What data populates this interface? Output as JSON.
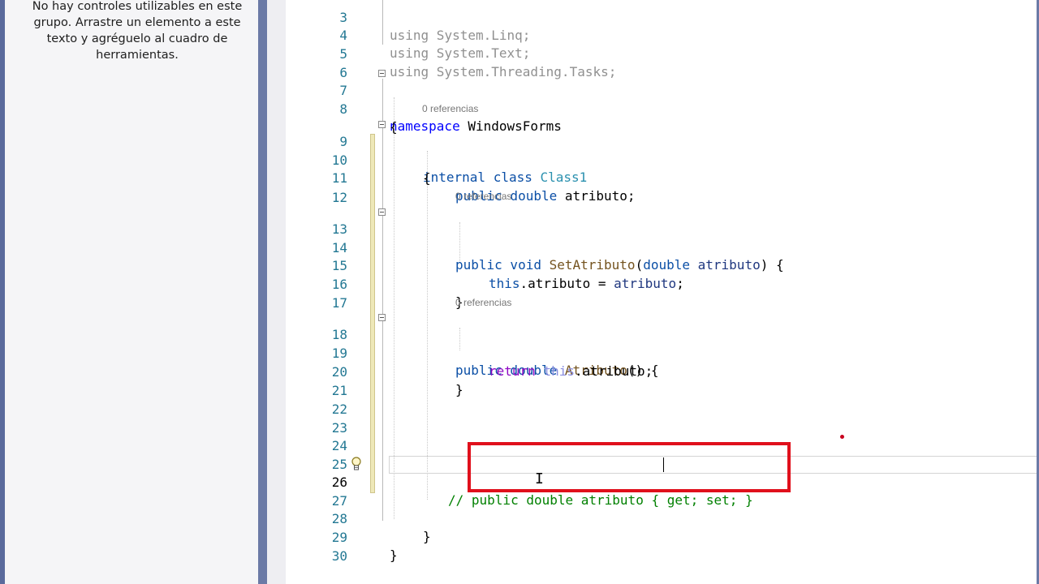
{
  "toolbox": {
    "message_line1": "No hay controles utilizables en este",
    "message_line2": "grupo. Arrastre un elemento a este",
    "message_line3": "texto y agréguelo al cuadro de",
    "message_line4": "herramientas."
  },
  "editor": {
    "codelens": {
      "class_refs": "0 referencias",
      "setatributo_refs": "0 referencias",
      "atributo_refs": "0 referencias"
    },
    "lines": {
      "l3": {
        "num": "3",
        "a": "using",
        "b": " System.Linq;"
      },
      "l4": {
        "num": "4",
        "a": "using",
        "b": " System.Text;"
      },
      "l5": {
        "num": "5",
        "a": "using",
        "b": " System.Threading.Tasks;"
      },
      "l6": {
        "num": "6"
      },
      "l7": {
        "num": "7",
        "a": "namespace",
        "b": " WindowsForms"
      },
      "l8": {
        "num": "8",
        "a": "{"
      },
      "l9": {
        "num": "9",
        "a": "internal class ",
        "b": "Class1"
      },
      "l10": {
        "num": "10",
        "a": "{"
      },
      "l11": {
        "num": "11",
        "a": "public double ",
        "b": "atributo;"
      },
      "l12": {
        "num": "12"
      },
      "l13": {
        "num": "13",
        "a": "public void ",
        "b": "SetAtributo",
        "c": "(",
        "d": "double ",
        "e": "atributo",
        "f": ") {"
      },
      "l14": {
        "num": "14"
      },
      "l15": {
        "num": "15",
        "a": "this",
        "b": ".atributo = ",
        "c": "atributo",
        "d": ";"
      },
      "l16": {
        "num": "16",
        "a": "}"
      },
      "l17": {
        "num": "17"
      },
      "l18": {
        "num": "18",
        "a": "public double ",
        "b": "Atributo",
        "c": "() {"
      },
      "l19": {
        "num": "19",
        "a": "return ",
        "b": "this",
        "c": ".atributo;"
      },
      "l20": {
        "num": "20",
        "a": "}"
      },
      "l21": {
        "num": "21"
      },
      "l22": {
        "num": "22"
      },
      "l23": {
        "num": "23"
      },
      "l24": {
        "num": "24"
      },
      "l25": {
        "num": "25"
      },
      "l26": {
        "num": "26",
        "a": "// public double atributo { get; set; }"
      },
      "l27": {
        "num": "27"
      },
      "l28": {
        "num": "28",
        "a": "}"
      },
      "l29": {
        "num": "29",
        "a": "}"
      },
      "l30": {
        "num": "30"
      }
    }
  },
  "colors": {
    "keyword": "#0000ff",
    "type": "#2b91af",
    "comment": "#008000",
    "highlight_box": "#e0101c"
  }
}
